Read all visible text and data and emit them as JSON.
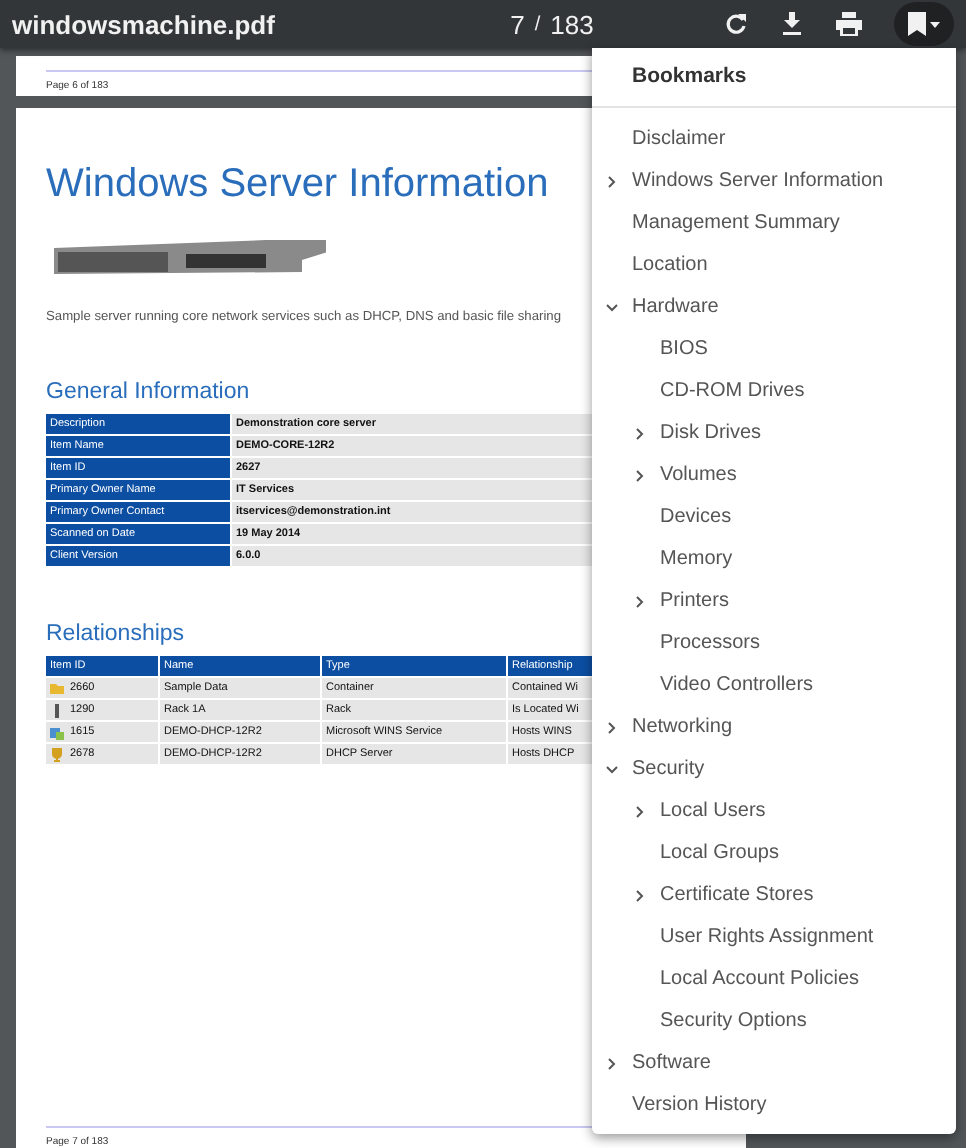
{
  "toolbar": {
    "filename": "windowsmachine.pdf",
    "page_current": "7",
    "page_separator": "/",
    "page_total": "183"
  },
  "previous_page": {
    "footer": "Page 6 of 183"
  },
  "page": {
    "title": "Windows Server Information",
    "caption": "Sample server running core network services such as DHCP, DNS and basic file sharing",
    "general": {
      "heading": "General Information",
      "rows": [
        {
          "label": "Description",
          "value": "Demonstration core server"
        },
        {
          "label": "Item Name",
          "value": "DEMO-CORE-12R2"
        },
        {
          "label": "Item ID",
          "value": "2627"
        },
        {
          "label": "Primary Owner Name",
          "value": "IT Services"
        },
        {
          "label": "Primary Owner Contact",
          "value": "itservices@demonstration.int"
        },
        {
          "label": "Scanned on Date",
          "value": "19 May 2014"
        },
        {
          "label": "Client Version",
          "value": "6.0.0"
        }
      ]
    },
    "relationships": {
      "heading": "Relationships",
      "columns": [
        "Item ID",
        "Name",
        "Type",
        "Relationship"
      ],
      "rows": [
        {
          "kind": "folder",
          "cells": [
            "2660",
            "Sample Data",
            "Container",
            "Contained Wi"
          ]
        },
        {
          "kind": "rack",
          "cells": [
            "1290",
            "Rack 1A",
            "Rack",
            "Is Located Wi"
          ]
        },
        {
          "kind": "service",
          "cells": [
            "1615",
            "DEMO-DHCP-12R2",
            "Microsoft WINS Service",
            "Hosts WINS"
          ]
        },
        {
          "kind": "server",
          "cells": [
            "2678",
            "DEMO-DHCP-12R2",
            "DHCP Server",
            "Hosts DHCP"
          ]
        }
      ]
    },
    "footer": "Page 7 of 183"
  },
  "bookmarks": {
    "title": "Bookmarks",
    "items": [
      {
        "label": "Disclaimer",
        "kind": "page"
      },
      {
        "label": "Windows Server Information",
        "kind": "group",
        "expanded": false
      },
      {
        "label": "Management Summary",
        "kind": "page"
      },
      {
        "label": "Location",
        "kind": "page"
      },
      {
        "label": "Hardware",
        "kind": "group",
        "expanded": true,
        "children": [
          {
            "label": "BIOS",
            "kind": "page"
          },
          {
            "label": "CD-ROM Drives",
            "kind": "page"
          },
          {
            "label": "Disk Drives",
            "kind": "group",
            "expanded": false
          },
          {
            "label": "Volumes",
            "kind": "group",
            "expanded": false
          },
          {
            "label": "Devices",
            "kind": "page"
          },
          {
            "label": "Memory",
            "kind": "page"
          },
          {
            "label": "Printers",
            "kind": "group",
            "expanded": false
          },
          {
            "label": "Processors",
            "kind": "page"
          },
          {
            "label": "Video Controllers",
            "kind": "page"
          }
        ]
      },
      {
        "label": "Networking",
        "kind": "group",
        "expanded": false
      },
      {
        "label": "Security",
        "kind": "group",
        "expanded": true,
        "children": [
          {
            "label": "Local Users",
            "kind": "group",
            "expanded": false
          },
          {
            "label": "Local Groups",
            "kind": "page"
          },
          {
            "label": "Certificate Stores",
            "kind": "group",
            "expanded": false
          },
          {
            "label": "User Rights Assignment",
            "kind": "page"
          },
          {
            "label": "Local Account Policies",
            "kind": "page"
          },
          {
            "label": "Security Options",
            "kind": "page"
          }
        ]
      },
      {
        "label": "Software",
        "kind": "group",
        "expanded": false
      },
      {
        "label": "Version History",
        "kind": "page"
      }
    ]
  }
}
